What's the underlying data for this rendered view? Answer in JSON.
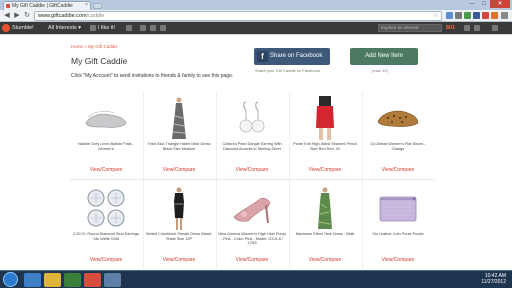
{
  "browser": {
    "tab_title": "My Gift Caddie | GiftCaddie",
    "tab_close": "×",
    "url_host": "www.giftcaddie.com",
    "url_path": "/caddie",
    "back": "◀",
    "forward": "▶",
    "reload": "↻",
    "win_min": "–",
    "win_max": "□",
    "win_close": "✕"
  },
  "stumblebar": {
    "stumble_label": "Stumble!",
    "interests_label": "All Interests ▾",
    "like_label": "I like it!",
    "explore_placeholder": "Explore an interest",
    "count": "601"
  },
  "page": {
    "breadcrumb": "Home » My Gift Caddie",
    "title": "My Gift Caddie",
    "instructions": "Click \"My Account\" to send invitations to friends & family to see this page.",
    "share_button": "Share on Facebook",
    "share_caption": "Share your Gift Caddie on Facebook",
    "add_button": "Add New Item",
    "add_caption": "(max 10)"
  },
  "products": [
    {
      "name": "Natalie Grey Linen Batiste Flats - Women's",
      "link": "View/Compare",
      "icon": "flat-shoe-icon",
      "color": "#c9c9cc"
    },
    {
      "name": "Tribe Bloc Triangle Halter Maxi Dress Black Size Medium",
      "link": "View/Compare",
      "icon": "maxi-dress-icon",
      "color": "#6b6b6b"
    },
    {
      "name": "Cultured Pearl Dangle Earring With Diamond Accents in Sterling Silver",
      "link": "View/Compare",
      "icon": "pearl-earrings-icon",
      "color": "#ececec"
    },
    {
      "name": "Ponte Knit High-Waist Seamed Pencil Skirt Red Red, 00",
      "link": "View/Compare",
      "icon": "pencil-skirt-icon",
      "color": "#d42631"
    },
    {
      "name": "Go Ahead Women's Flat Shoes - Orange",
      "link": "View/Compare",
      "icon": "leopard-flat-icon",
      "color": "#b07a3a"
    },
    {
      "name": "2.00 Ct. Round Diamond Stud Earrings 14k White Gold",
      "link": "View/Compare",
      "icon": "diamond-studs-icon",
      "color": "#dfe4ea"
    },
    {
      "name": "Belted Colorblock Sheath Dress Black/ Shale Size 12P",
      "link": "View/Compare",
      "icon": "sheath-dress-icon",
      "color": "#1e1e1e"
    },
    {
      "name": "Nina Geneva Women's High Heel Pump - Pink - Color: Pink - Model: GXJL-6 / 17NS",
      "link": "View/Compare",
      "icon": "pink-pump-icon",
      "color": "#d9a3a8"
    },
    {
      "name": "Maximum Effect Tank Dress - Multi",
      "link": "View/Compare",
      "icon": "tank-dress-icon",
      "color": "#5b8a4c"
    },
    {
      "name": "Siu Leather Coin Purse Purple",
      "link": "View/Compare",
      "icon": "coin-purse-icon",
      "color": "#c6b6dc"
    }
  ],
  "clock": {
    "time": "10:42 AM",
    "date": "11/27/2012"
  }
}
